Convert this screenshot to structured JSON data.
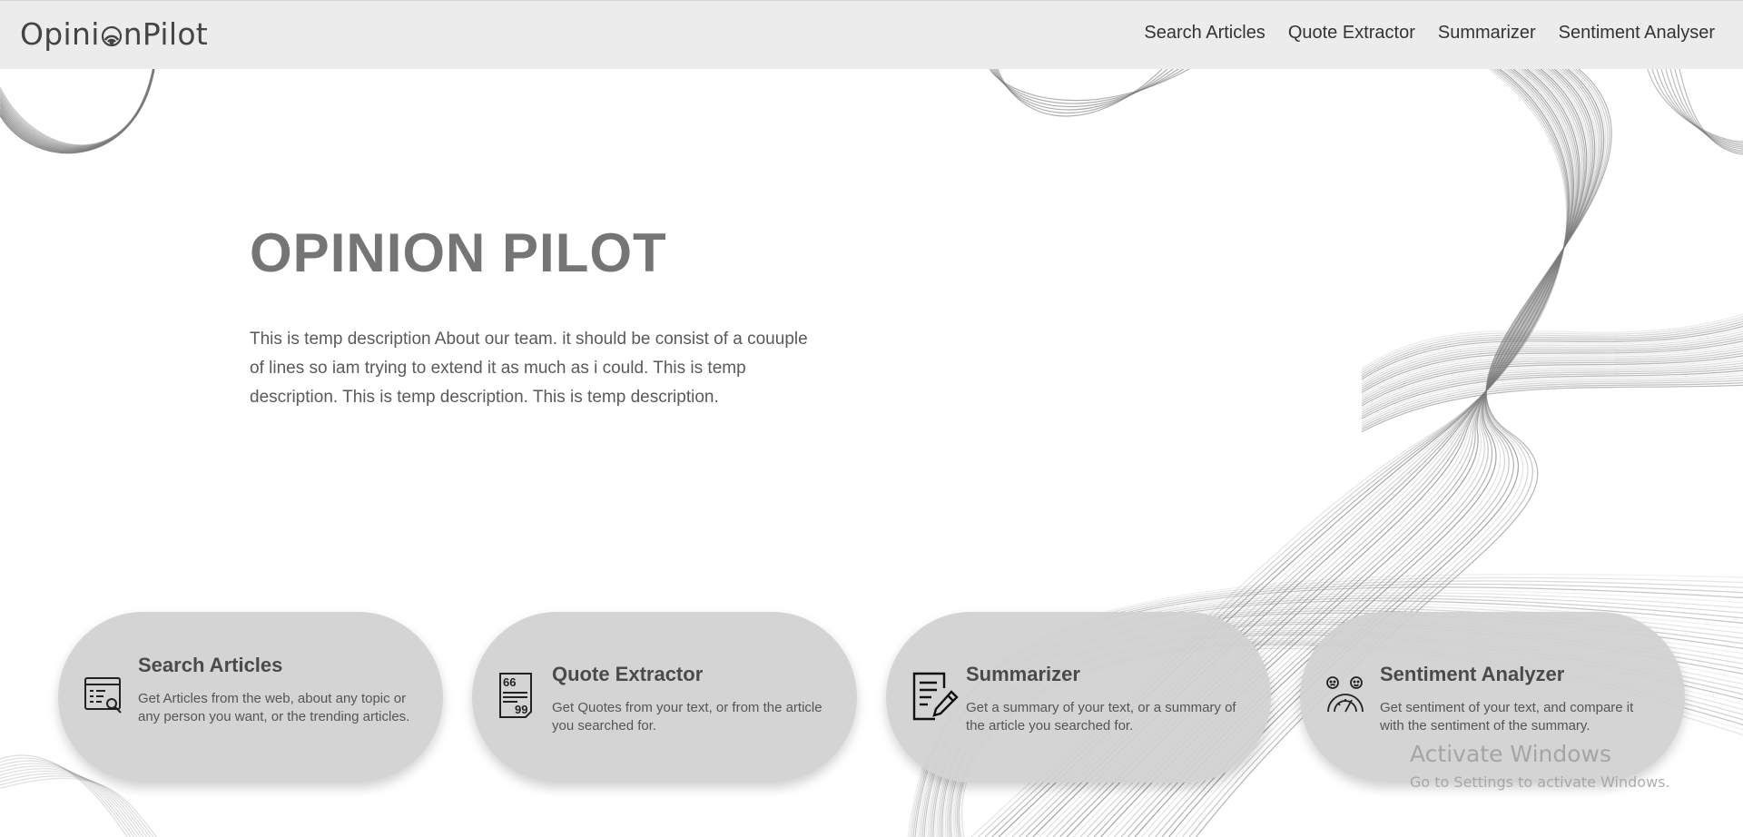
{
  "header": {
    "logo_prefix": "Opini",
    "logo_suffix": "nPilot",
    "nav": [
      {
        "label": "Search Articles"
      },
      {
        "label": "Quote Extractor"
      },
      {
        "label": "Summarizer"
      },
      {
        "label": "Sentiment Analyser"
      }
    ]
  },
  "hero": {
    "title": "OPINION PILOT",
    "description": "This is temp description About our team. it should be consist of a couuple of lines so iam trying to extend it as much as i could. This is temp description. This is temp description. This is temp description."
  },
  "cards": [
    {
      "title": "Search Articles",
      "description": "Get Articles from the web, about any topic or any person you want, or the trending articles.",
      "icon": "search-window-icon"
    },
    {
      "title": "Quote Extractor",
      "description": "Get Quotes from your text, or from the article you searched for.",
      "icon": "quote-document-icon"
    },
    {
      "title": "Summarizer",
      "description": "Get a summary of your text, or a summary of the article you searched for.",
      "icon": "document-pen-icon"
    },
    {
      "title": "Sentiment Analyzer",
      "description": "Get sentiment of your text, and compare it with the sentiment of the summary.",
      "icon": "sentiment-faces-icon"
    }
  ],
  "watermark": {
    "title": "Activate Windows",
    "subtitle": "Go to Settings to activate Windows."
  }
}
